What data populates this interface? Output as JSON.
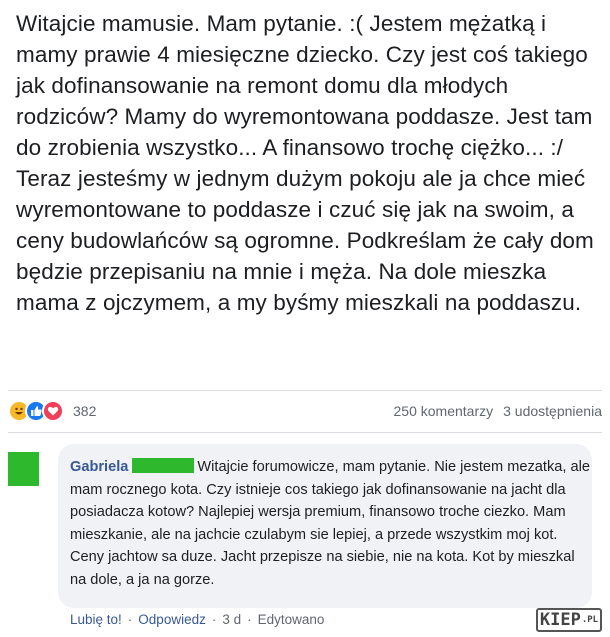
{
  "post": {
    "text": "Witajcie mamusie. Mam pytanie. :( Jestem mężatką i mamy prawie 4 miesięczne dziecko. Czy jest coś takiego jak dofinansowanie na remont domu dla młodych rodziców? Mamy do wyremontowana poddasze. Jest tam do zrobienia wszystko... A finansowo trochę ciężko... :/ Teraz jesteśmy w jednym dużym pokoju ale ja chce mieć wyremontowane to poddasze i czuć się jak na swoim, a ceny budowlańców są ogromne. Podkreślam że cały dom będzie przepisaniu na mnie i męża. Na dole mieszka mama z ojczymem, a my byśmy mieszkali na poddaszu."
  },
  "reactions": {
    "icons": [
      "haha-icon",
      "like-icon",
      "love-icon"
    ],
    "count": "382",
    "comments": "250 komentarzy",
    "shares": "3 udostępnienia"
  },
  "comment": {
    "author": "Gabriela",
    "text": "Witajcie forumowicze, mam pytanie. Nie jestem mezatka, ale mam rocznego kota. Czy istnieje cos takiego jak dofinansowanie na jacht dla posiadacza kotow? Najlepiej wersja premium, finansowo troche ciezko. Mam mieszkanie, ale na jachcie czulabym sie lepiej, a przede wszystkim moj kot. Ceny jachtow sa duze. Jacht przepisze na siebie, nie na kota. Kot by mieszkal na dole, a ja na gorze.",
    "actions": {
      "like": "Lubię to!",
      "reply": "Odpowiedz",
      "time": "3 d",
      "edited": "Edytowano"
    }
  },
  "watermark": {
    "main": "KIEP",
    "suffix": ".PL"
  },
  "colors": {
    "redaction": "#2eb82e",
    "author": "#385898",
    "bubble": "#f0f2f5"
  }
}
